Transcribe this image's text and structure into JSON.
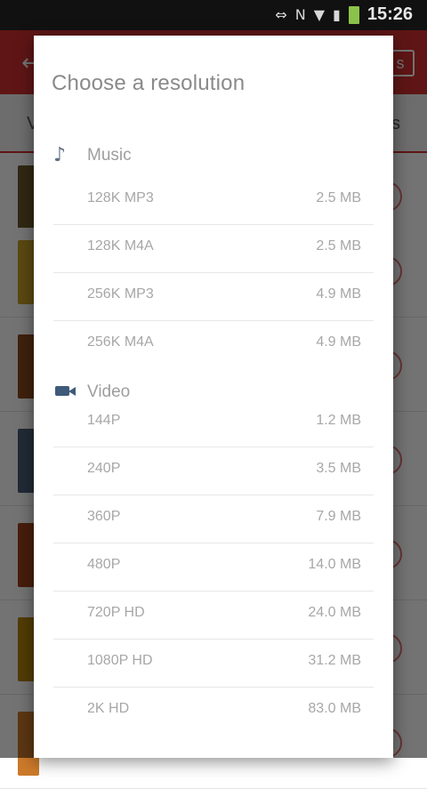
{
  "status_bar": {
    "time": "15:26",
    "icons": [
      "link-icon",
      "nfc-icon",
      "wifi-icon",
      "signal-icon",
      "battery-icon"
    ]
  },
  "background_app": {
    "tab_left": "V",
    "tab_right": "s",
    "action_label": "s"
  },
  "dialog": {
    "title": "Choose a resolution",
    "music": {
      "label": "Music",
      "options": [
        {
          "name": "128K MP3",
          "size": "2.5 MB"
        },
        {
          "name": "128K M4A",
          "size": "2.5 MB"
        },
        {
          "name": "256K MP3",
          "size": "4.9 MB"
        },
        {
          "name": "256K M4A",
          "size": "4.9 MB"
        }
      ]
    },
    "video": {
      "label": "Video",
      "options": [
        {
          "name": "144P",
          "size": "1.2 MB"
        },
        {
          "name": "240P",
          "size": "3.5 MB"
        },
        {
          "name": "360P",
          "size": "7.9 MB"
        },
        {
          "name": "480P",
          "size": "14.0 MB"
        },
        {
          "name": "720P HD",
          "size": "24.0 MB"
        },
        {
          "name": "1080P HD",
          "size": "31.2 MB"
        },
        {
          "name": "2K HD",
          "size": "83.0 MB"
        }
      ]
    }
  },
  "colors": {
    "accent": "#d32f2f",
    "battery": "#8bc34a"
  }
}
